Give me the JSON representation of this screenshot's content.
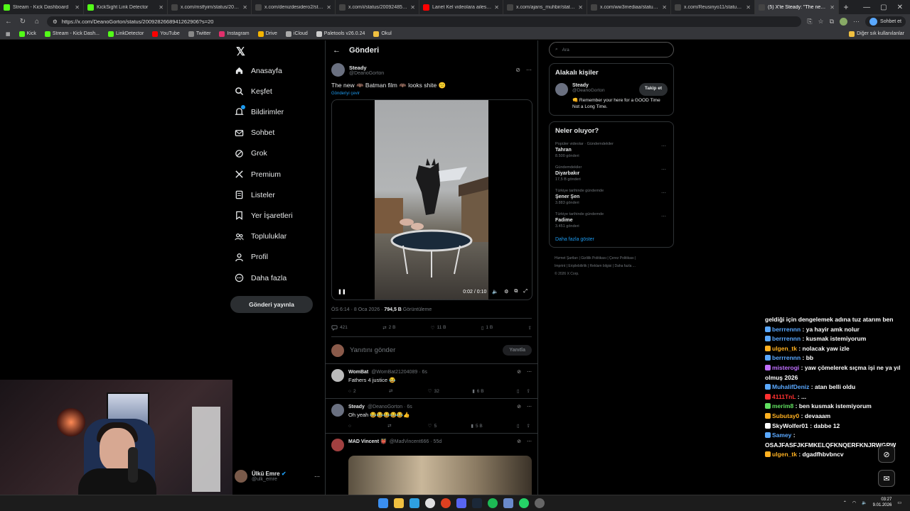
{
  "browser": {
    "tabs": [
      {
        "label": "Stream - Kick Dashboard",
        "color": "#53fc18"
      },
      {
        "label": "KickSight Link Detector",
        "color": "#53fc18"
      },
      {
        "label": "x.com/mstfyim/status/20092363",
        "color": "#444"
      },
      {
        "label": "x.com/denizdesidero2/status/20",
        "color": "#444"
      },
      {
        "label": "x.com/i/status/2009248571548",
        "color": "#444"
      },
      {
        "label": "Lanet Kel videolara ailesi ne tepk",
        "color": "#ff0000"
      },
      {
        "label": "x.com/ajans_muhbir/status/2009",
        "color": "#444"
      },
      {
        "label": "x.com/ww3mediaa/status/20090",
        "color": "#444"
      },
      {
        "label": "x.com/Reusinyo11/status/20092",
        "color": "#444"
      },
      {
        "label": "(5) X'te Steady: \"The new ...\" Bat",
        "color": "#444",
        "active": true
      }
    ],
    "url": "https://x.com/DeanoGorton/status/2009282668941262906?s=20",
    "profile_button": "Sohbet et",
    "bookmarks": [
      {
        "label": "Kick",
        "color": "#53fc18"
      },
      {
        "label": "Stream - Kick Dash...",
        "color": "#53fc18"
      },
      {
        "label": "LinkDetector",
        "color": "#53fc18"
      },
      {
        "label": "YouTube",
        "color": "#ff0000"
      },
      {
        "label": "Twitter",
        "color": "#888"
      },
      {
        "label": "Instagram",
        "color": "#e1306c"
      },
      {
        "label": "Drive",
        "color": "#f4b400"
      },
      {
        "label": "iCloud",
        "color": "#aaa"
      },
      {
        "label": "Paletools v26.0.24",
        "color": "#ccc"
      },
      {
        "label": "Okul",
        "color": "#f0c040"
      }
    ],
    "bookmarks_right": "Diğer sık kullanılanlar"
  },
  "nav": {
    "items": [
      {
        "label": "Anasayfa",
        "icon": "home-icon"
      },
      {
        "label": "Keşfet",
        "icon": "search-icon"
      },
      {
        "label": "Bildirimler",
        "icon": "bell-icon"
      },
      {
        "label": "Sohbet",
        "icon": "mail-icon"
      },
      {
        "label": "Grok",
        "icon": "grok-icon"
      },
      {
        "label": "Premium",
        "icon": "x-icon"
      },
      {
        "label": "Listeler",
        "icon": "list-icon"
      },
      {
        "label": "Yer İşaretleri",
        "icon": "bookmark-icon"
      },
      {
        "label": "Topluluklar",
        "icon": "people-icon"
      },
      {
        "label": "Profil",
        "icon": "person-icon"
      },
      {
        "label": "Daha fazla",
        "icon": "more-circle-icon"
      }
    ],
    "post_button": "Gönderi yayınla",
    "user": {
      "name": "Ülkü Emre",
      "handle": "@ulk_emre"
    }
  },
  "main": {
    "header": "Gönderi",
    "post": {
      "name": "Steady",
      "handle": "@DeanoGorton",
      "text": "The new 🦇 Batman film 🦇 looks shite 😕",
      "translate": "Gönderiyi çevir",
      "video_time": "0:02 / 0:10",
      "meta_time": "ÖS 6:14 · 8 Oca 2026 · ",
      "views": "794,5 B",
      "views_label": " Görüntüleme",
      "replies": "421",
      "reposts": "2 B",
      "likes": "11 B",
      "bookmarks": "1 B"
    },
    "reply_placeholder": "Yanıtını gönder",
    "reply_button": "Yanıtla",
    "replies": [
      {
        "name": "WomBat",
        "handle": "@WomBat21204089 · 6s",
        "text": "Fathers 4 justice 😂",
        "replies": "2",
        "reposts": "",
        "likes": "32",
        "views": "6 B"
      },
      {
        "name": "Steady",
        "handle": "@DeanoGorton · 6s",
        "text": "Oh yeah 😂😂😂😂😂👍",
        "replies": "",
        "reposts": "",
        "likes": "5",
        "views": "5 B"
      },
      {
        "name": "MAD Vincent 👹",
        "handle": "@MadVincent666 · 55d",
        "text": "",
        "replies": "",
        "reposts": "",
        "likes": "",
        "views": ""
      }
    ]
  },
  "right": {
    "search_placeholder": "Ara",
    "related_title": "Alakalı kişiler",
    "related": {
      "name": "Steady",
      "handle": "@DeanoGorton",
      "follow": "Takip et",
      "bio": "👊 Remember your here for a GOOD Time Not a Long Time."
    },
    "trends_title": "Neler oluyor?",
    "trends": [
      {
        "ctx": "Popüler videolar · Gündemdekiler",
        "name": "Tahran",
        "count": "8.500 gönderi"
      },
      {
        "ctx": "Gündemdekiler",
        "name": "Diyarbakır",
        "count": "17,5 B gönderi"
      },
      {
        "ctx": "Türkiye tarihinde gündemde",
        "name": "Şener Şen",
        "count": "3.883 gönderi"
      },
      {
        "ctx": "Türkiye tarihinde gündemde",
        "name": "Fadime",
        "count": "3.451 gönderi"
      }
    ],
    "show_more": "Daha fazla göster",
    "footer1": "Hizmet Şartları  |  Gizlilik Politikası  |  Çerez Politikası  |",
    "footer2": "Imprint  |  Erişilebilirlik  |  Reklam bilgisi  |  Daha fazla ...",
    "footer3": "© 2026 X Corp."
  },
  "chat": [
    {
      "nick": "",
      "color": "#fff",
      "text": "geldiği için dengelemek adına tuz atarım ben"
    },
    {
      "nick": "berrrennn",
      "color": "#5aa8ff",
      "text": ": ya hayir amk nolur"
    },
    {
      "nick": "berrrennn",
      "color": "#5aa8ff",
      "text": ": kusmak istemiyorum"
    },
    {
      "nick": "ulgen_tk",
      "color": "#ffb020",
      "text": ": nolacak yaw izle"
    },
    {
      "nick": "berrrennn",
      "color": "#5aa8ff",
      "text": ": bb"
    },
    {
      "nick": "misterogi",
      "color": "#c070ff",
      "text": ": yaw çömelerek sıçma işi ne ya yıl olmuş 2026"
    },
    {
      "nick": "MuhalifDeniz",
      "color": "#5aa8ff",
      "text": ": atan belli oldu"
    },
    {
      "nick": "4111TnL",
      "color": "#ff3030",
      "text": ": ..."
    },
    {
      "nick": "merim8",
      "color": "#60e060",
      "text": ": ben kusmak istemiyorum"
    },
    {
      "nick": "Subutay0",
      "color": "#ffb020",
      "text": ": devaaam"
    },
    {
      "nick": "SkyWolfer01",
      "color": "#fff",
      "text": ": dabbe 12"
    },
    {
      "nick": "Samey",
      "color": "#5aa8ff",
      "text": ":"
    },
    {
      "nick": "",
      "color": "#fff",
      "text": "OSAJFASFJKFMKELQFKNQERFKNJRWGRW"
    },
    {
      "nick": "ulgen_tk",
      "color": "#ffb020",
      "text": ": dgadfhbvbncv"
    }
  ],
  "taskbar": {
    "time": "03:27",
    "date": "9.01.2026"
  }
}
